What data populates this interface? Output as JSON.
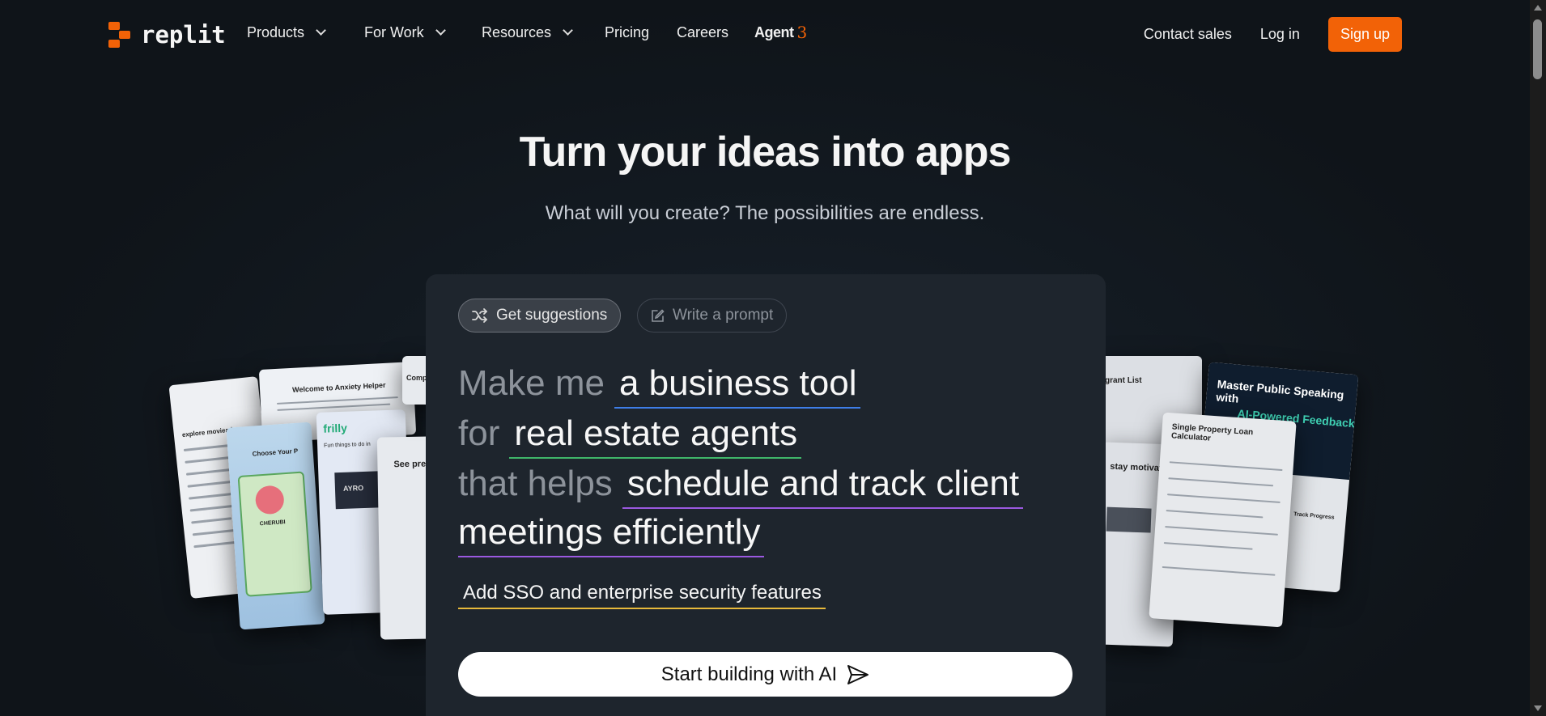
{
  "nav": {
    "logo_text": "replit",
    "items": [
      {
        "label": "Products",
        "has_dropdown": true
      },
      {
        "label": "For Work",
        "has_dropdown": true
      },
      {
        "label": "Resources",
        "has_dropdown": true
      },
      {
        "label": "Pricing",
        "has_dropdown": false
      },
      {
        "label": "Careers",
        "has_dropdown": false
      }
    ],
    "agent_label": "Agent",
    "agent_version": "3",
    "contact_sales": "Contact sales",
    "log_in": "Log in",
    "sign_up": "Sign up"
  },
  "hero": {
    "title": "Turn your ideas into apps",
    "subtitle": "What will you create? The possibilities are endless."
  },
  "panel": {
    "tabs": {
      "get_suggestions": "Get suggestions",
      "write_prompt": "Write a prompt"
    },
    "prompt": {
      "lead1": "Make me",
      "fill1": "a business tool",
      "lead2": "for",
      "fill2": "real estate agents",
      "lead3": "that helps",
      "fill3a": "schedule and track client",
      "fill3b": "meetings efficiently"
    },
    "extra_feature": "Add SSO and enterprise security features",
    "cta_label": "Start building with AI"
  },
  "showcase": {
    "left_cards": [
      "Welcome to Anxiety Helper",
      "explore movies in",
      "Choose Your P",
      "CHERUBI",
      "frilly",
      "Fun things to do in",
      "AYRO",
      "See pre",
      "Comp"
    ],
    "right_cards": [
      "grant List",
      "Master Public Speaking with",
      "AI-Powered Feedback",
      "Single Property Loan Calculator",
      "stay motivated",
      "Track Progress"
    ]
  },
  "colors": {
    "brand": "#f26207",
    "background": "#0f1419",
    "panel": "#1e252d",
    "underline_blue": "#3e7ee8",
    "underline_green": "#3fb66a",
    "underline_purple": "#9b59e0",
    "underline_yellow": "#e7b93b"
  }
}
